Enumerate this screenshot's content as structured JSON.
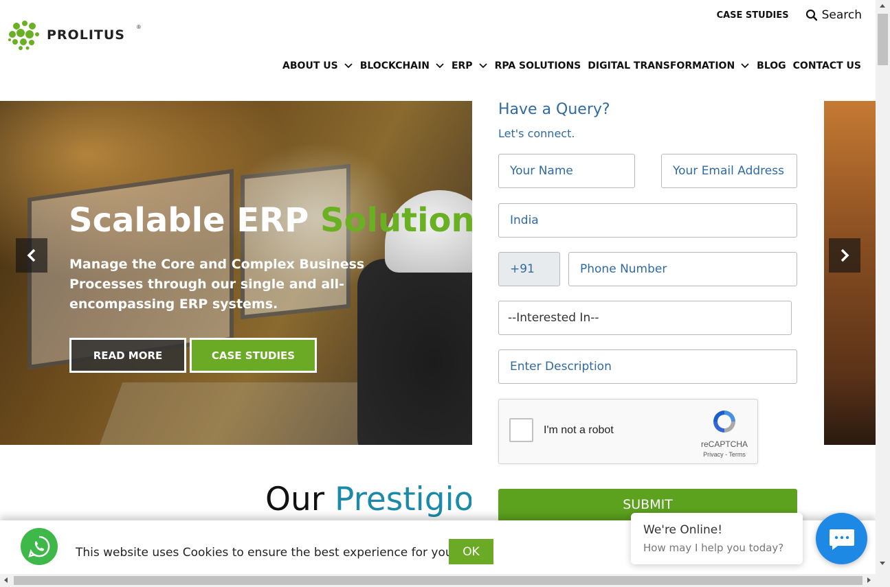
{
  "brand": {
    "name": "PROLITUS",
    "reg": "®",
    "accent": "#6ab023"
  },
  "topnav": {
    "case_studies": "CASE STUDIES",
    "search": "Search"
  },
  "mainnav": [
    {
      "label": "ABOUT US",
      "dropdown": true
    },
    {
      "label": "BLOCKCHAIN",
      "dropdown": true
    },
    {
      "label": "ERP",
      "dropdown": true
    },
    {
      "label": "RPA SOLUTIONS",
      "dropdown": false
    },
    {
      "label": "DIGITAL TRANSFORMATION",
      "dropdown": true
    },
    {
      "label": "BLOG",
      "dropdown": false
    },
    {
      "label": "CONTACT US",
      "dropdown": false
    }
  ],
  "hero": {
    "title_main": "Scalable ERP ",
    "title_accent": "Solution",
    "description": "Manage the Core and Complex Business Processes through our single and all-encompassing ERP systems.",
    "read_more": "READ MORE",
    "case_studies": "CASE STUDIES"
  },
  "form": {
    "title": "Have a Query?",
    "subtitle": "Let's connect.",
    "name_placeholder": "Your Name",
    "email_placeholder": "Your Email Address",
    "country": "India",
    "phone_code": "+91",
    "phone_placeholder": "Phone Number",
    "interest": "--Interested In--",
    "description_placeholder": "Enter Description",
    "captcha_label": "I'm not a robot",
    "captcha_brand": "reCAPTCHA",
    "captcha_terms": "Privacy - Terms",
    "submit": "SUBMIT"
  },
  "section": {
    "heading_main": "Our ",
    "heading_accent": "Prestigious"
  },
  "cookie": {
    "text": "This website uses Cookies to ensure the best experience for you.",
    "ok": "OK"
  },
  "chat": {
    "status": "We're Online!",
    "prompt": "How may I help you today?"
  }
}
